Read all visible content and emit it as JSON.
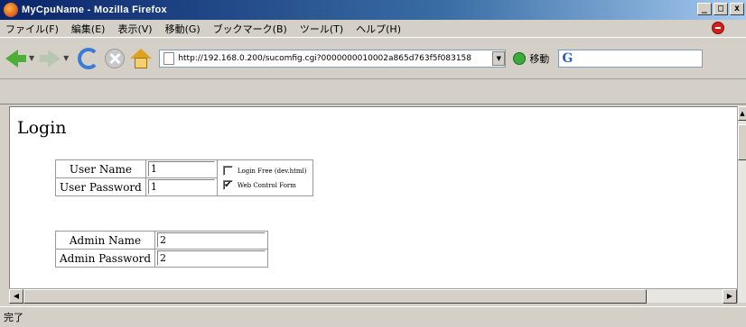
{
  "window": {
    "title": "MyCpuName - Mozilla Firefox",
    "controls": {
      "minimize": "_",
      "maximize": "□",
      "close": "x"
    }
  },
  "menubar": {
    "items": [
      "ファイル(F)",
      "編集(E)",
      "表示(V)",
      "移動(G)",
      "ブックマーク(B)",
      "ツール(T)",
      "ヘルプ(H)"
    ]
  },
  "toolbar": {
    "url": "http://192.168.0.200/sucomfig.cgi?0000000010002a865d763f5f083158",
    "go_label": "移動",
    "search_placeholder": "G"
  },
  "page": {
    "title": "Login",
    "user_form": {
      "user_name_label": "User Name",
      "user_name_value": "1",
      "user_password_label": "User Password",
      "user_password_value": "1",
      "option_login_free_label": "Login Free (dev.html)",
      "option_login_free_checked": false,
      "option_web_control_label": "Web Control Form",
      "option_web_control_checked": true
    },
    "admin_form": {
      "admin_name_label": "Admin Name",
      "admin_name_value": "2",
      "admin_password_label": "Admin Password",
      "admin_password_value": "2"
    }
  },
  "status": {
    "text": "完了"
  }
}
